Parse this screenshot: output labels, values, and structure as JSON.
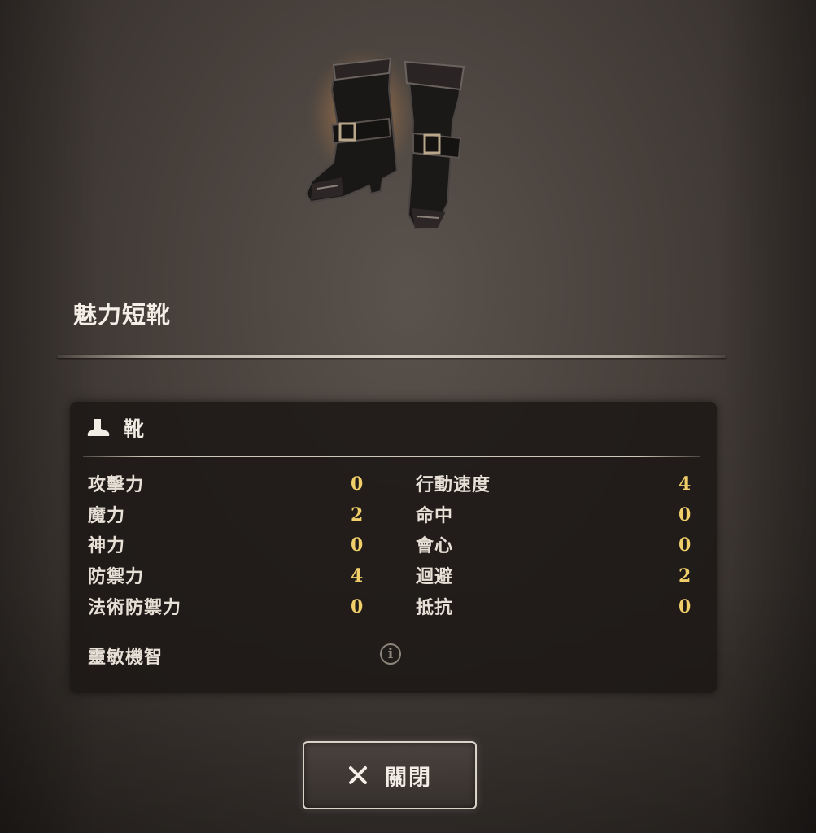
{
  "item": {
    "name": "魅力短靴",
    "image": "leather-boots-icon"
  },
  "category": {
    "icon": "boot-icon",
    "label": "靴"
  },
  "stats": {
    "left": [
      {
        "name": "攻擊力",
        "value": "0"
      },
      {
        "name": "魔力",
        "value": "2"
      },
      {
        "name": "神力",
        "value": "0"
      },
      {
        "name": "防禦力",
        "value": "4"
      },
      {
        "name": "法術防禦力",
        "value": "0"
      }
    ],
    "right": [
      {
        "name": "行動速度",
        "value": "4"
      },
      {
        "name": "命中",
        "value": "0"
      },
      {
        "name": "會心",
        "value": "0"
      },
      {
        "name": "迴避",
        "value": "2"
      },
      {
        "name": "抵抗",
        "value": "0"
      }
    ]
  },
  "trait": {
    "name": "靈敏機智",
    "info_icon": "info-icon",
    "info_glyph": "i"
  },
  "close_button": {
    "icon": "close-icon",
    "label": "關閉"
  },
  "colors": {
    "value": "#f0cf6a",
    "panel": "#1c1816",
    "glow": "#ffbe78"
  }
}
